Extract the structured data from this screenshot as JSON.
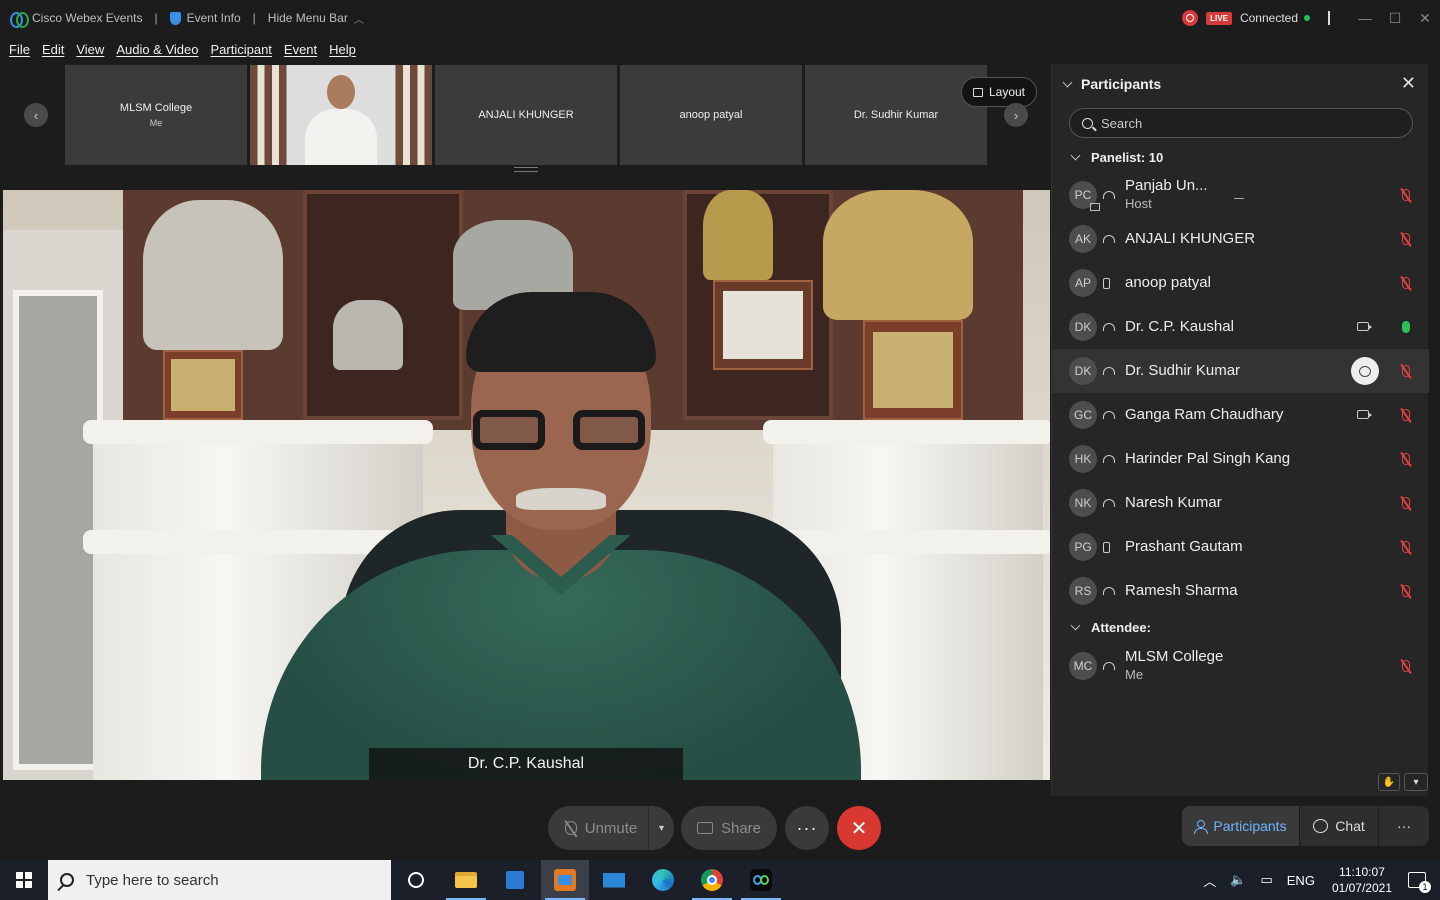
{
  "titlebar": {
    "app_name": "Cisco Webex Events",
    "event_info": "Event Info",
    "hide_menu": "Hide Menu Bar",
    "live": "LIVE",
    "status": "Connected"
  },
  "menu": [
    "File",
    "Edit",
    "View",
    "Audio & Video",
    "Participant",
    "Event",
    "Help"
  ],
  "thumbnails": [
    {
      "name": "MLSM College",
      "sub": "Me"
    },
    {
      "name": "",
      "sub": ""
    },
    {
      "name": "ANJALI KHUNGER",
      "sub": ""
    },
    {
      "name": "anoop patyal",
      "sub": ""
    },
    {
      "name": "Dr. Sudhir Kumar",
      "sub": ""
    }
  ],
  "layout_label": "Layout",
  "active_speaker": "Dr. C.P. Kaushal",
  "controls": {
    "unmute": "Unmute",
    "share": "Share",
    "more": "···",
    "end": "✕"
  },
  "panel": {
    "title": "Participants",
    "search_placeholder": "Search",
    "panelist_header": "Panelist: 10",
    "attendee_header": "Attendee:",
    "panelists": [
      {
        "initials": "PC",
        "name": "Panjab Un...",
        "sub": "Host",
        "device": "headset",
        "camera": false,
        "mic": "muted"
      },
      {
        "initials": "AK",
        "name": "ANJALI KHUNGER",
        "sub": "",
        "device": "headset",
        "camera": false,
        "mic": "muted"
      },
      {
        "initials": "AP",
        "name": "anoop patyal",
        "sub": "",
        "device": "phone",
        "camera": false,
        "mic": "muted"
      },
      {
        "initials": "DK",
        "name": "Dr. C.P. Kaushal",
        "sub": "",
        "device": "headset",
        "camera": true,
        "mic": "on"
      },
      {
        "initials": "DK",
        "name": "Dr. Sudhir Kumar",
        "sub": "",
        "device": "headset",
        "camera": false,
        "mic": "muted"
      },
      {
        "initials": "GC",
        "name": "Ganga Ram Chaudhary",
        "sub": "",
        "device": "headset",
        "camera": true,
        "mic": "muted"
      },
      {
        "initials": "HK",
        "name": "Harinder Pal Singh Kang",
        "sub": "",
        "device": "headset",
        "camera": false,
        "mic": "muted"
      },
      {
        "initials": "NK",
        "name": "Naresh Kumar",
        "sub": "",
        "device": "headset",
        "camera": false,
        "mic": "muted"
      },
      {
        "initials": "PG",
        "name": "Prashant Gautam",
        "sub": "",
        "device": "phone",
        "camera": false,
        "mic": "muted"
      },
      {
        "initials": "RS",
        "name": "Ramesh Sharma",
        "sub": "",
        "device": "headset",
        "camera": false,
        "mic": "muted"
      }
    ],
    "attendees": [
      {
        "initials": "MC",
        "name": "MLSM College",
        "sub": "Me",
        "device": "headset",
        "camera": false,
        "mic": "muted"
      }
    ]
  },
  "panel_tabs": {
    "participants": "Participants",
    "chat": "Chat",
    "more": "···"
  },
  "taskbar": {
    "search_placeholder": "Type here to search",
    "lang": "ENG",
    "time": "11:10:07",
    "date": "01/07/2021",
    "notifications": "1"
  }
}
